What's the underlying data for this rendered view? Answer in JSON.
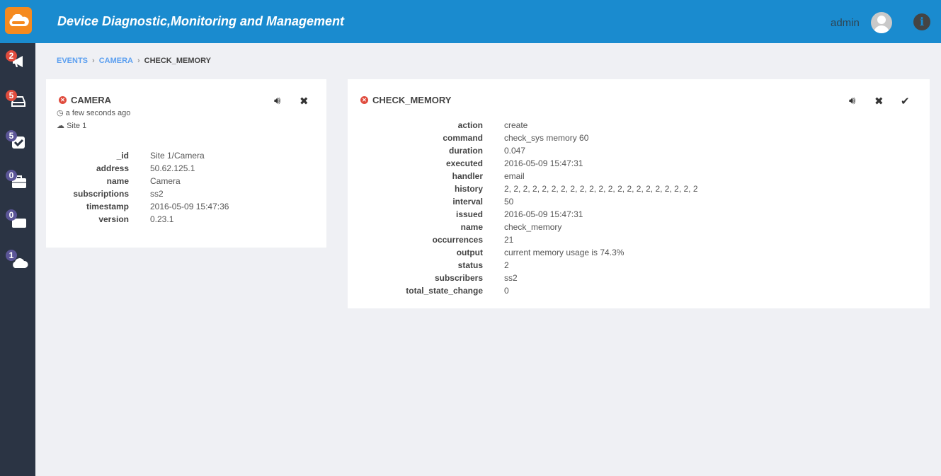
{
  "header": {
    "title": "Device Diagnostic,Monitoring and Management",
    "user": "admin"
  },
  "sidebar": [
    {
      "icon": "megaphone-icon",
      "count": "2",
      "color": "#e04b3d"
    },
    {
      "icon": "server-icon",
      "count": "5",
      "color": "#e04b3d"
    },
    {
      "icon": "check-square-icon",
      "count": "5",
      "color": "#5b5597"
    },
    {
      "icon": "toolbox-icon",
      "count": "0",
      "color": "#5b5597"
    },
    {
      "icon": "folder-icon",
      "count": "0",
      "color": "#5b5597"
    },
    {
      "icon": "cloud-icon",
      "count": "1",
      "color": "#5b5597"
    }
  ],
  "breadcrumb": {
    "items": [
      "EVENTS",
      "CAMERA"
    ],
    "current": "CHECK_MEMORY"
  },
  "client": {
    "title": "CAMERA",
    "time": "a few seconds ago",
    "site": "Site 1",
    "fields": [
      [
        "_id",
        "Site 1/Camera"
      ],
      [
        "address",
        "50.62.125.1"
      ],
      [
        "name",
        "Camera"
      ],
      [
        "subscriptions",
        "ss2"
      ],
      [
        "timestamp",
        "2016-05-09 15:47:36"
      ],
      [
        "version",
        "0.23.1"
      ]
    ]
  },
  "check": {
    "title": "CHECK_MEMORY",
    "fields": [
      [
        "action",
        "create"
      ],
      [
        "command",
        "check_sys memory 60"
      ],
      [
        "duration",
        "0.047"
      ],
      [
        "executed",
        "2016-05-09 15:47:31"
      ],
      [
        "handler",
        "email"
      ],
      [
        "history",
        "2, 2, 2, 2, 2, 2, 2, 2, 2, 2, 2, 2, 2, 2, 2, 2, 2, 2, 2, 2, 2"
      ],
      [
        "interval",
        "50"
      ],
      [
        "issued",
        "2016-05-09 15:47:31"
      ],
      [
        "name",
        "check_memory"
      ],
      [
        "occurrences",
        "21"
      ],
      [
        "output",
        "current memory usage is 74.3%"
      ],
      [
        "status",
        "2"
      ],
      [
        "subscribers",
        "ss2"
      ],
      [
        "total_state_change",
        "0"
      ]
    ]
  }
}
